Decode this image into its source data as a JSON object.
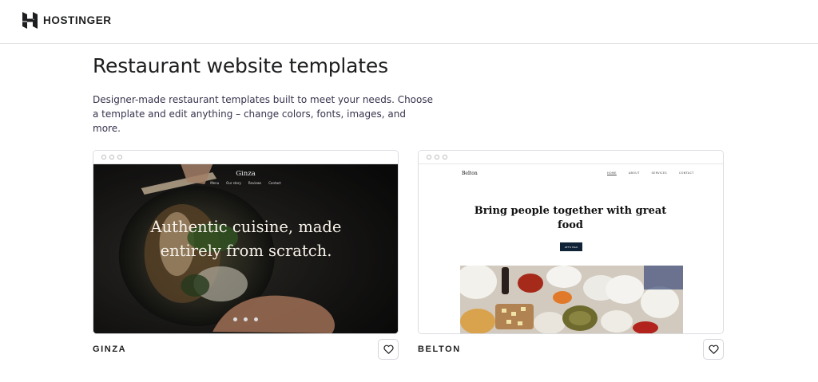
{
  "header": {
    "brand": "HOSTINGER",
    "logo_icon": "hostinger-logo-icon"
  },
  "main": {
    "title": "Restaurant website templates",
    "description": "Designer-made restaurant templates built to meet your needs. Choose a template and edit anything – change colors, fonts, images, and more."
  },
  "templates": [
    {
      "name": "GINZA",
      "favorite_icon": "heart-outline-icon",
      "preview": {
        "brand": "Ginza",
        "nav": [
          "Menu",
          "Our story",
          "Reviews",
          "Contact"
        ],
        "headline": "Authentic cuisine, made entirely from scratch.",
        "social_icons": [
          "twitter-icon",
          "facebook-icon",
          "instagram-icon"
        ]
      }
    },
    {
      "name": "BELTON",
      "favorite_icon": "heart-outline-icon",
      "preview": {
        "brand": "Belton",
        "nav": [
          "HOME",
          "ABOUT",
          "SERVICES",
          "CONTACT"
        ],
        "headline": "Bring people together with great food",
        "cta": "LET'S TALK"
      }
    }
  ],
  "colors": {
    "text": "#1d1e20",
    "muted_text": "#36344d",
    "border": "#dadce0",
    "belton_cta": "#0f2236"
  }
}
